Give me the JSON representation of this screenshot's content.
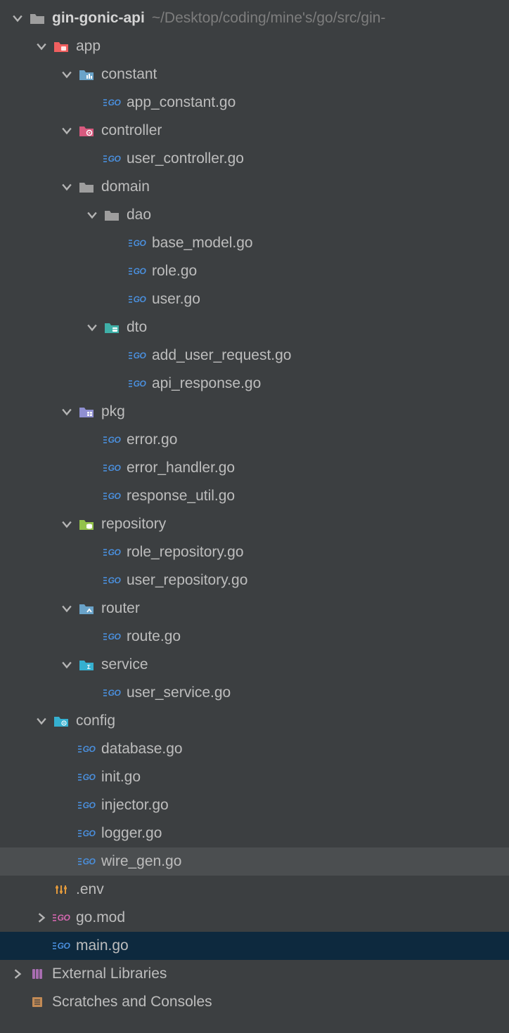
{
  "root": {
    "name": "gin-gonic-api",
    "path_hint": "~/Desktop/coding/mine's/go/src/gin-"
  },
  "tree": {
    "app": {
      "label": "app",
      "constant": {
        "label": "constant",
        "files": {
          "app_constant": "app_constant.go"
        }
      },
      "controller": {
        "label": "controller",
        "files": {
          "user_controller": "user_controller.go"
        }
      },
      "domain": {
        "label": "domain",
        "dao": {
          "label": "dao",
          "files": {
            "base_model": "base_model.go",
            "role": "role.go",
            "user": "user.go"
          }
        },
        "dto": {
          "label": "dto",
          "files": {
            "add_user_request": "add_user_request.go",
            "api_response": "api_response.go"
          }
        }
      },
      "pkg": {
        "label": "pkg",
        "files": {
          "error": "error.go",
          "error_handler": "error_handler.go",
          "response_util": "response_util.go"
        }
      },
      "repository": {
        "label": "repository",
        "files": {
          "role_repository": "role_repository.go",
          "user_repository": "user_repository.go"
        }
      },
      "router": {
        "label": "router",
        "files": {
          "route": "route.go"
        }
      },
      "service": {
        "label": "service",
        "files": {
          "user_service": "user_service.go"
        }
      }
    },
    "config": {
      "label": "config",
      "files": {
        "database": "database.go",
        "init": "init.go",
        "injector": "injector.go",
        "logger": "logger.go",
        "wire_gen": "wire_gen.go"
      }
    },
    "root_files": {
      "env": ".env",
      "go_mod": "go.mod",
      "main": "main.go"
    }
  },
  "bottom": {
    "external_libraries": "External Libraries",
    "scratches": "Scratches and Consoles"
  }
}
